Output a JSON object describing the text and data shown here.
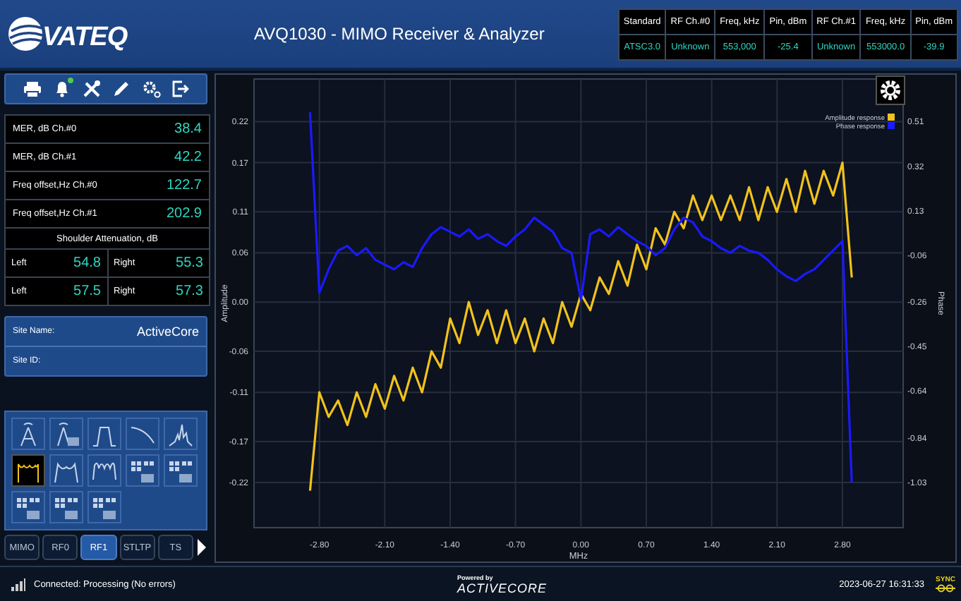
{
  "header": {
    "logo": "VATEQ",
    "title": "AVQ1030 - MIMO Receiver & Analyzer",
    "table": {
      "columns": [
        "Standard",
        "RF Ch.#0",
        "Freq, kHz",
        "Pin, dBm",
        "RF Ch.#1",
        "Freq, kHz",
        "Pin, dBm"
      ],
      "row": [
        "ATSC3.0",
        "Unknown",
        "553,000",
        "-25.4",
        "Unknown",
        "553000.0",
        "-39.9"
      ]
    }
  },
  "toolbar": [
    {
      "kind": "print",
      "badge": false
    },
    {
      "kind": "bell",
      "badge": true
    },
    {
      "kind": "tools",
      "badge": false
    },
    {
      "kind": "pencil",
      "badge": false
    },
    {
      "kind": "gears",
      "badge": false
    },
    {
      "kind": "exit",
      "badge": false
    }
  ],
  "metrics": {
    "rows": [
      {
        "label": "MER, dB Ch.#0",
        "value": "38.4"
      },
      {
        "label": "MER, dB Ch.#1",
        "value": "42.2"
      },
      {
        "label": "Freq offset,Hz Ch.#0",
        "value": "122.7"
      },
      {
        "label": "Freq offset,Hz Ch.#1",
        "value": "202.9"
      }
    ],
    "shoulder": {
      "title": "Shoulder Attenuation, dB",
      "rows": [
        {
          "left_label": "Left",
          "left_value": "54.8",
          "right_label": "Right",
          "right_value": "55.3"
        },
        {
          "left_label": "Left",
          "left_value": "57.5",
          "right_label": "Right",
          "right_value": "57.3"
        }
      ]
    }
  },
  "site": [
    {
      "label": "Site Name:",
      "value": "ActiveCore"
    },
    {
      "label": "Site ID:"
    }
  ],
  "modes": [
    {
      "kind": "antenna",
      "selected": false
    },
    {
      "kind": "antenna_badge",
      "selected": false
    },
    {
      "kind": "mask",
      "selected": false
    },
    {
      "kind": "rolloff",
      "selected": false
    },
    {
      "kind": "spectrum",
      "selected": false
    },
    {
      "kind": "response",
      "selected": true
    },
    {
      "kind": "response_wide",
      "selected": false
    },
    {
      "kind": "ripple",
      "selected": false
    },
    {
      "kind": "grid_badge",
      "selected": false
    },
    {
      "kind": "grid_badge",
      "selected": false
    },
    {
      "kind": "grid_badge",
      "selected": false
    },
    {
      "kind": "grid_badge",
      "selected": false
    },
    {
      "kind": "grid_badge",
      "selected": false
    }
  ],
  "tabs": [
    {
      "label": "MIMO",
      "selected": false
    },
    {
      "label": "RF0",
      "selected": false
    },
    {
      "label": "RF1",
      "selected": true
    },
    {
      "label": "STLTP",
      "selected": false
    },
    {
      "label": "TS",
      "selected": false
    }
  ],
  "chart": {
    "chart_data": {
      "type": "line",
      "xlabel": "MHz",
      "ylabel": "Amplitude",
      "y2label": "Phase",
      "x": [
        -2.9,
        -2.8,
        -2.7,
        -2.6,
        -2.5,
        -2.4,
        -2.3,
        -2.2,
        -2.1,
        -2.0,
        -1.9,
        -1.8,
        -1.7,
        -1.6,
        -1.5,
        -1.4,
        -1.3,
        -1.2,
        -1.1,
        -1.0,
        -0.9,
        -0.8,
        -0.7,
        -0.6,
        -0.5,
        -0.4,
        -0.3,
        -0.2,
        -0.1,
        0.0,
        0.1,
        0.2,
        0.3,
        0.4,
        0.5,
        0.6,
        0.7,
        0.8,
        0.9,
        1.0,
        1.1,
        1.2,
        1.3,
        1.4,
        1.5,
        1.6,
        1.7,
        1.8,
        1.9,
        2.0,
        2.1,
        2.2,
        2.3,
        2.4,
        2.5,
        2.6,
        2.7,
        2.8,
        2.9
      ],
      "series": [
        {
          "name": "Amplitude response",
          "color": "#f2c21b",
          "axis": "y",
          "values": [
            -0.23,
            -0.11,
            -0.14,
            -0.12,
            -0.15,
            -0.11,
            -0.14,
            -0.1,
            -0.13,
            -0.09,
            -0.12,
            -0.08,
            -0.11,
            -0.06,
            -0.08,
            -0.02,
            -0.05,
            0.0,
            -0.04,
            -0.01,
            -0.05,
            -0.01,
            -0.05,
            -0.02,
            -0.06,
            -0.02,
            -0.05,
            0.0,
            -0.03,
            0.01,
            -0.01,
            0.03,
            0.01,
            0.05,
            0.02,
            0.07,
            0.04,
            0.09,
            0.07,
            0.11,
            0.09,
            0.13,
            0.1,
            0.13,
            0.1,
            0.13,
            0.1,
            0.14,
            0.1,
            0.14,
            0.11,
            0.15,
            0.11,
            0.16,
            0.12,
            0.16,
            0.13,
            0.17,
            0.03
          ]
        },
        {
          "name": "Phase response",
          "color": "#1a1aff",
          "axis": "y2",
          "values": [
            0.55,
            -0.22,
            -0.12,
            -0.04,
            -0.02,
            -0.06,
            -0.03,
            -0.08,
            -0.1,
            -0.12,
            -0.09,
            -0.11,
            -0.03,
            0.03,
            0.06,
            0.04,
            0.02,
            0.05,
            0.01,
            0.03,
            0.0,
            -0.02,
            0.02,
            0.05,
            0.1,
            0.07,
            0.04,
            -0.03,
            -0.05,
            -0.25,
            0.03,
            0.05,
            0.02,
            0.06,
            0.03,
            0.0,
            -0.02,
            -0.06,
            -0.03,
            0.05,
            0.1,
            0.08,
            0.02,
            0.0,
            -0.03,
            -0.05,
            -0.02,
            -0.04,
            -0.05,
            -0.08,
            -0.12,
            -0.15,
            -0.17,
            -0.14,
            -0.12,
            -0.08,
            -0.04,
            0.0,
            -1.03
          ]
        }
      ],
      "xlim": [
        -3.5,
        3.45
      ],
      "ylim": [
        -0.275,
        0.272
      ],
      "y2lim": [
        -1.2225,
        0.692
      ],
      "xticks": [
        {
          "value": -2.8,
          "label": "-2.80"
        },
        {
          "value": -2.1,
          "label": "-2.10"
        },
        {
          "value": -1.4,
          "label": "-1.40"
        },
        {
          "value": -0.7,
          "label": "-0.70"
        },
        {
          "value": 0,
          "label": "0.00"
        },
        {
          "value": 0.7,
          "label": "0.70"
        },
        {
          "value": 1.4,
          "label": "1.40"
        },
        {
          "value": 2.1,
          "label": "2.10"
        },
        {
          "value": 2.8,
          "label": "2.80"
        }
      ],
      "yticks": [
        {
          "value": 0.22,
          "label": "0.22"
        },
        {
          "value": 0.17,
          "label": "0.17"
        },
        {
          "value": 0.11,
          "label": "0.11"
        },
        {
          "value": 0.06,
          "label": "0.06"
        },
        {
          "value": 0,
          "label": "0.00"
        },
        {
          "value": -0.06,
          "label": "-0.06"
        },
        {
          "value": -0.11,
          "label": "-0.11"
        },
        {
          "value": -0.17,
          "label": "-0.17"
        },
        {
          "value": -0.22,
          "label": "-0.22"
        }
      ],
      "y2ticks": [
        {
          "value": 0.51,
          "label": "0.51"
        },
        {
          "value": 0.32,
          "label": "0.32"
        },
        {
          "value": 0.13,
          "label": "0.13"
        },
        {
          "value": -0.06,
          "label": "-0.06"
        },
        {
          "value": -0.26,
          "label": "-0.26"
        },
        {
          "value": -0.45,
          "label": "-0.45"
        },
        {
          "value": -0.64,
          "label": "-0.64"
        },
        {
          "value": -0.84,
          "label": "-0.84"
        },
        {
          "value": -1.03,
          "label": "-1.03"
        }
      ],
      "grid": true,
      "legend": true
    }
  },
  "status_bar": {
    "message": "Connected: Processing (No errors)",
    "powered_by": "Powered by",
    "brand": "ACTIVECORE",
    "timestamp": "2023-06-27 16:31:33",
    "sync": "SYNC"
  }
}
